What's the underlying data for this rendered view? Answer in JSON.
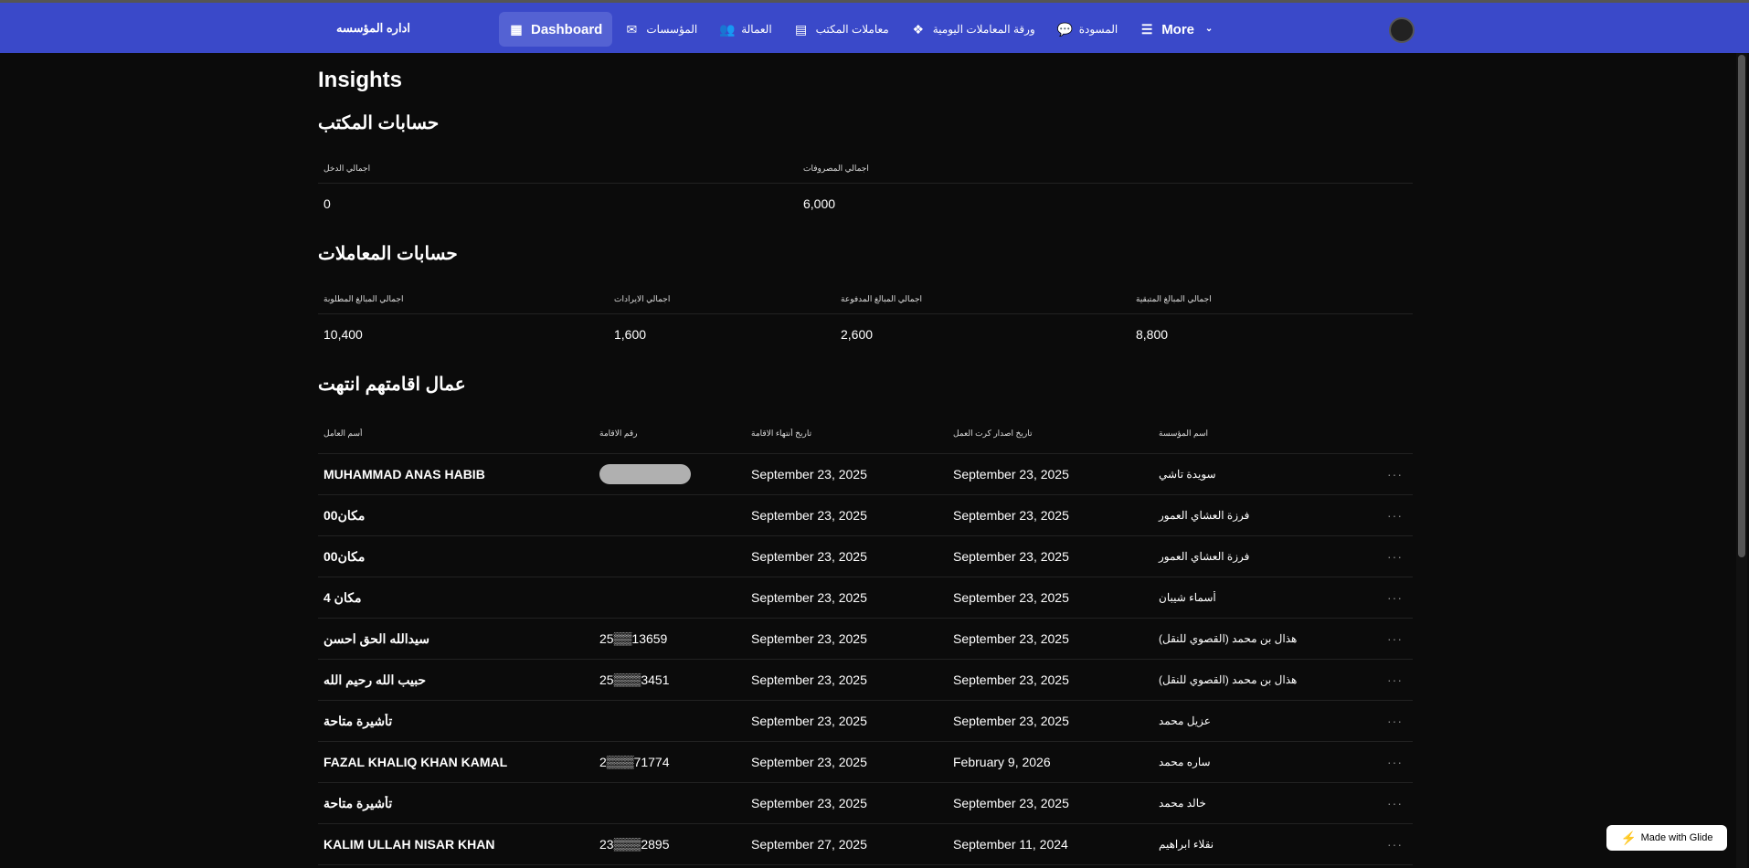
{
  "nav": {
    "brand": "اداره المؤسسه",
    "items": [
      {
        "label": "Dashboard",
        "icon": "grid-icon",
        "active": true
      },
      {
        "label": "المؤسسات",
        "icon": "mail-check-icon"
      },
      {
        "label": "العمالة",
        "icon": "users-icon"
      },
      {
        "label": "معاملات المكتب",
        "icon": "document-icon"
      },
      {
        "label": "ورقة المعاملات اليومية",
        "icon": "diamond-cluster-icon"
      },
      {
        "label": "المسودة",
        "icon": "chat-bubble-icon"
      },
      {
        "label": "More",
        "icon": "menu-icon"
      }
    ]
  },
  "page_title": "Insights",
  "office": {
    "title": "حسابات المكتب",
    "stats": [
      {
        "label": "اجمالي الدخل",
        "value": "0"
      },
      {
        "label": "اجمالي المصروفات",
        "value": "6,000"
      }
    ]
  },
  "transactions": {
    "title": "حسابات المعاملات",
    "stats": [
      {
        "label": "اجمالي المبالغ المطلوبة",
        "value": "10,400"
      },
      {
        "label": "اجمالي الايرادات",
        "value": "1,600"
      },
      {
        "label": "اجمالي المبالغ المدفوعة",
        "value": "2,600"
      },
      {
        "label": "اجمالي المبالغ المتبقية",
        "value": "8,800"
      }
    ]
  },
  "workers": {
    "title": "عمال اقامتهم انتهت",
    "columns": [
      "أسم العامل",
      "رقم الاقامة",
      "تاريخ أنتهاء الاقامة",
      "تاريخ اصدار كرت العمل",
      "اسم المؤسسة"
    ],
    "rows": [
      {
        "name": "MUHAMMAD ANAS HABIB",
        "iqama": "",
        "redacted": true,
        "expiry": "September 23, 2025",
        "issue": "September 23, 2025",
        "company": "سويدة تاشي"
      },
      {
        "name": "مكان00",
        "iqama": "",
        "redacted": false,
        "expiry": "September 23, 2025",
        "issue": "September 23, 2025",
        "company": "فرزة العشاي العمور"
      },
      {
        "name": "مكان00",
        "iqama": "",
        "redacted": false,
        "expiry": "September 23, 2025",
        "issue": "September 23, 2025",
        "company": "فرزة العشاي العمور"
      },
      {
        "name": "مكان 4",
        "iqama": "",
        "redacted": false,
        "expiry": "September 23, 2025",
        "issue": "September 23, 2025",
        "company": "أسماء شيبان"
      },
      {
        "name": "سيدالله الحق احسن",
        "iqama": "25▒▒13659",
        "redacted": false,
        "expiry": "September 23, 2025",
        "issue": "September 23, 2025",
        "company": "هذال بن محمد (القصوي للنقل)"
      },
      {
        "name": "حبيب الله رحيم الله",
        "iqama": "25▒▒▒3451",
        "redacted": false,
        "expiry": "September 23, 2025",
        "issue": "September 23, 2025",
        "company": "هذال بن محمد (القصوي للنقل)"
      },
      {
        "name": "تأشيرة متاحة",
        "iqama": "",
        "redacted": false,
        "expiry": "September 23, 2025",
        "issue": "September 23, 2025",
        "company": "عزيل محمد"
      },
      {
        "name": "FAZAL KHALIQ KHAN KAMAL",
        "iqama": "2▒▒▒71774",
        "redacted": false,
        "expiry": "September 23, 2025",
        "issue": "February 9, 2026",
        "company": "ساره محمد"
      },
      {
        "name": "تأشيرة متاحة",
        "iqama": "",
        "redacted": false,
        "expiry": "September 23, 2025",
        "issue": "September 23, 2025",
        "company": "خالد محمد"
      },
      {
        "name": "KALIM ULLAH NISAR KHAN",
        "iqama": "23▒▒▒2895",
        "redacted": false,
        "expiry": "September 27, 2025",
        "issue": "September 11, 2024",
        "company": "نقلاء ابراهيم"
      }
    ]
  },
  "badge": {
    "label": "Made with Glide"
  },
  "colors": {
    "nav": "#3a49c9",
    "background": "#0b0b0b"
  }
}
